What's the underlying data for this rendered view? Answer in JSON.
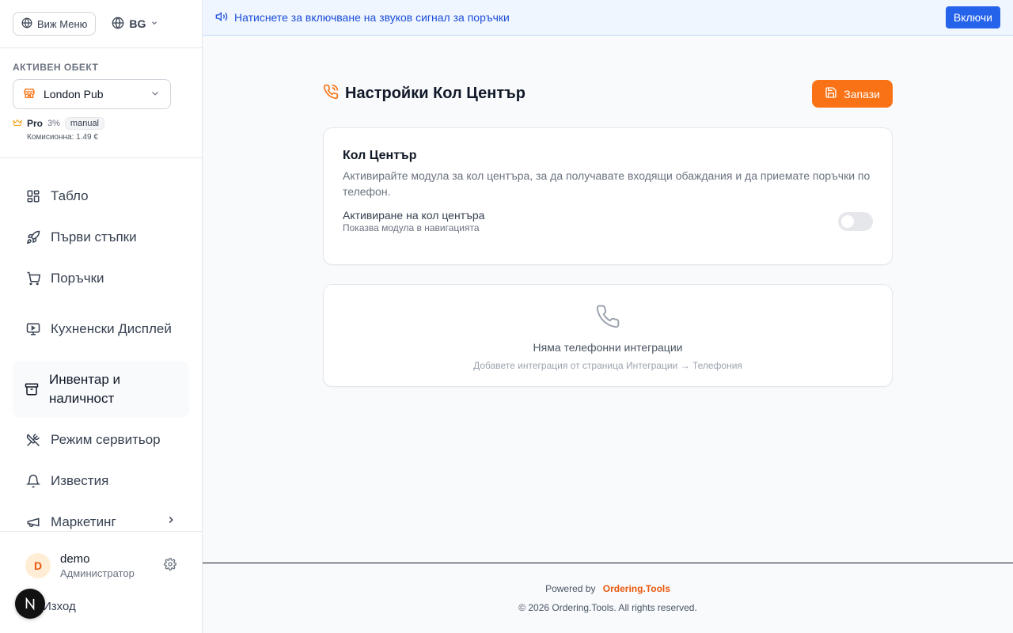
{
  "sidebar": {
    "menu_button": "Виж Меню",
    "language": "BG",
    "active_object_label": "АКТИВЕН ОБЕКТ",
    "object_name": "London Pub",
    "plan_name": "Pro",
    "plan_percent": "3%",
    "plan_badge": "manual",
    "commission": "Комисионна: 1.49 €",
    "nav": {
      "dashboard": "Табло",
      "first_steps": "Първи стъпки",
      "orders": "Поръчки",
      "kitchen": "Кухненски Дисплей",
      "inventory": "Инвентар и наличност",
      "waiter": "Режим сервитьор",
      "notifications": "Известия",
      "marketing": "Маркетинг"
    },
    "user_name": "demo",
    "user_initial": "D",
    "user_role": "Администратор",
    "logout": "Изход"
  },
  "banner": {
    "text": "Натиснете за включване на звуков сигнал за поръчки",
    "button": "Включи"
  },
  "page": {
    "title": "Настройки Кол Център",
    "save": "Запази",
    "card_title": "Кол Център",
    "card_desc": "Активирайте модула за кол центъра, за да получавате входящи обаждания и да приемате поръчки по телефон.",
    "toggle_label": "Активиране на кол центъра",
    "toggle_hint": "Показва модула в навигацията",
    "toggle_on": false,
    "empty_title": "Няма телефонни интеграции",
    "empty_hint": "Добавете интеграция от страница Интеграции → Телефония"
  },
  "footer": {
    "powered_by": "Powered by",
    "brand": "Ordering.Tools",
    "copyright": "© 2026 Ordering.Tools. All rights reserved."
  },
  "colors": {
    "accent": "#f97316",
    "banner_button": "#2563eb"
  }
}
